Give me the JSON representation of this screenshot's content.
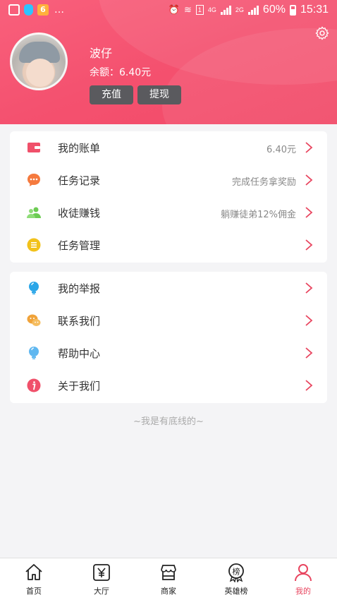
{
  "status_bar": {
    "battery": "60%",
    "time": "15:31",
    "network": "4G",
    "network2": "2G",
    "sim": "1"
  },
  "profile": {
    "name": "波仔",
    "balance_text": "余额：6.40元",
    "recharge_label": "充值",
    "withdraw_label": "提现"
  },
  "menu_group_1": [
    {
      "label": "我的账单",
      "meta": "6.40元",
      "icon": "wallet-icon",
      "color": "#f0506a"
    },
    {
      "label": "任务记录",
      "meta": "完成任务拿奖励",
      "icon": "chat-bubble-icon",
      "color": "#f57a3e"
    },
    {
      "label": "收徒赚钱",
      "meta": "躺赚徒弟12%佣金",
      "icon": "users-icon",
      "color": "#6ccb53"
    },
    {
      "label": "任务管理",
      "meta": "",
      "icon": "list-icon",
      "color": "#f2c21b"
    }
  ],
  "menu_group_2": [
    {
      "label": "我的举报",
      "meta": "",
      "icon": "bulb-icon",
      "color": "#2aa6e8"
    },
    {
      "label": "联系我们",
      "meta": "",
      "icon": "wechat-icon",
      "color": "#f0a33a"
    },
    {
      "label": "帮助中心",
      "meta": "",
      "icon": "help-bulb-icon",
      "color": "#5fb7f0"
    },
    {
      "label": "关于我们",
      "meta": "",
      "icon": "info-icon",
      "color": "#f0506a"
    }
  ],
  "footnote": "~我是有底线的~",
  "tabs": [
    {
      "label": "首页",
      "icon": "home-icon",
      "active": false
    },
    {
      "label": "大厅",
      "icon": "yen-icon",
      "active": false
    },
    {
      "label": "商家",
      "icon": "shop-icon",
      "active": false
    },
    {
      "label": "英雄榜",
      "icon": "rank-badge-icon",
      "active": false,
      "glyph": "榜"
    },
    {
      "label": "我的",
      "icon": "user-icon",
      "active": true
    }
  ],
  "colors": {
    "accent": "#f24a68",
    "active_tab": "#e8455f",
    "chevron": "#e8455f"
  }
}
